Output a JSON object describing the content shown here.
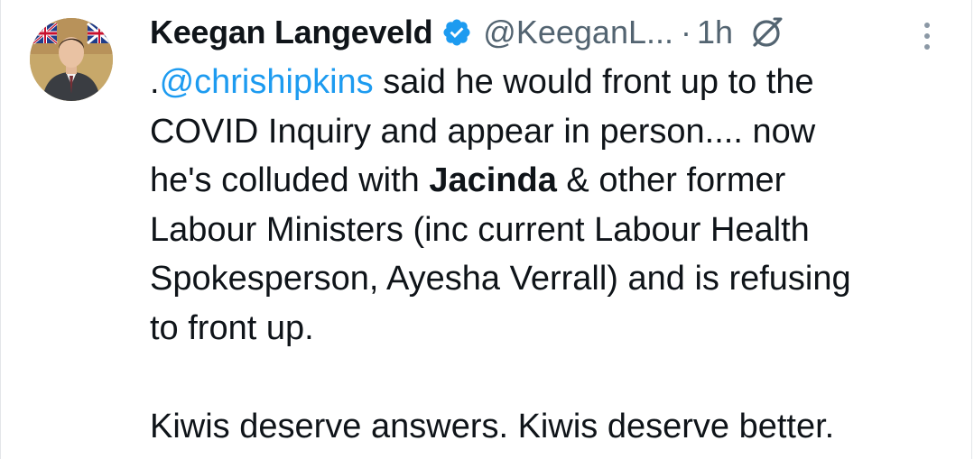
{
  "tweet": {
    "display_name": "Keegan Langeveld",
    "handle": "@KeeganL...",
    "dot": "·",
    "time": "1h",
    "verified_icon": "verified-badge-icon",
    "grok_icon": "grok-icon",
    "more_icon": "more-vertical-icon",
    "avatar": "profile-avatar",
    "colors": {
      "text": "#0f1419",
      "secondary": "#536471",
      "link": "#1d9bf0",
      "verified": "#1d9bf0"
    },
    "body": {
      "line1_prefix": ".",
      "mention": "@chrishipkins",
      "line1_rest": " said he would front up to the",
      "line2": "COVID Inquiry and appear in person.... now",
      "line3_prefix": "he's colluded with ",
      "line3_bold": "Jacinda",
      "line3_rest": " & other former",
      "line4": "Labour Ministers (inc current Labour Health",
      "line5": "Spokesperson, Ayesha Verrall) and is refusing",
      "line6": "to front up.",
      "line7": "Kiwis deserve answers. Kiwis deserve better."
    }
  }
}
